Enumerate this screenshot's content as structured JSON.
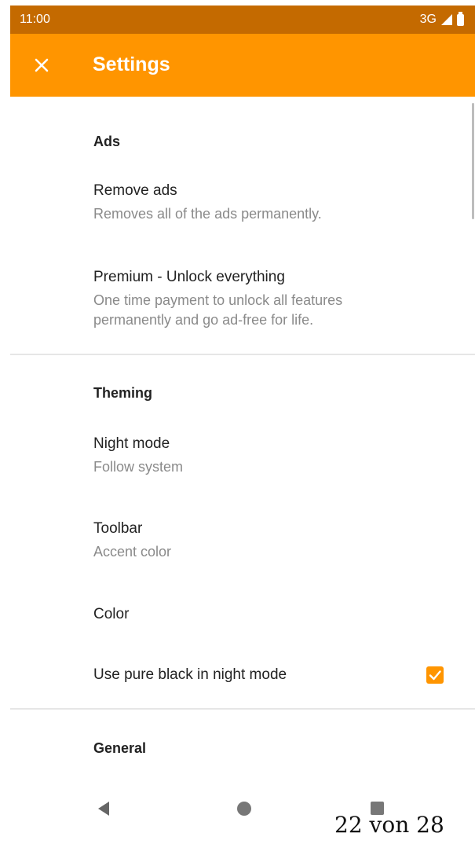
{
  "status_bar": {
    "time": "11:00",
    "network": "3G"
  },
  "toolbar": {
    "title": "Settings"
  },
  "sections": {
    "ads": {
      "header": "Ads",
      "remove_ads": {
        "title": "Remove ads",
        "summary": "Removes all of the ads permanently."
      },
      "premium": {
        "title": "Premium - Unlock everything",
        "summary_line1": "One time payment to unlock all features",
        "summary_line2": "permanently and go ad-free for life."
      }
    },
    "theming": {
      "header": "Theming",
      "night_mode": {
        "title": "Night mode",
        "summary": "Follow system"
      },
      "toolbar_pref": {
        "title": "Toolbar",
        "summary": "Accent color"
      },
      "color": {
        "title": "Color"
      },
      "pure_black": {
        "title": "Use pure black in night mode",
        "checked": true
      }
    },
    "general": {
      "header": "General"
    }
  },
  "colors": {
    "accent": "#ff9500",
    "status_bar": "#c46a00"
  },
  "footer": {
    "page_text": "22 von 28"
  }
}
